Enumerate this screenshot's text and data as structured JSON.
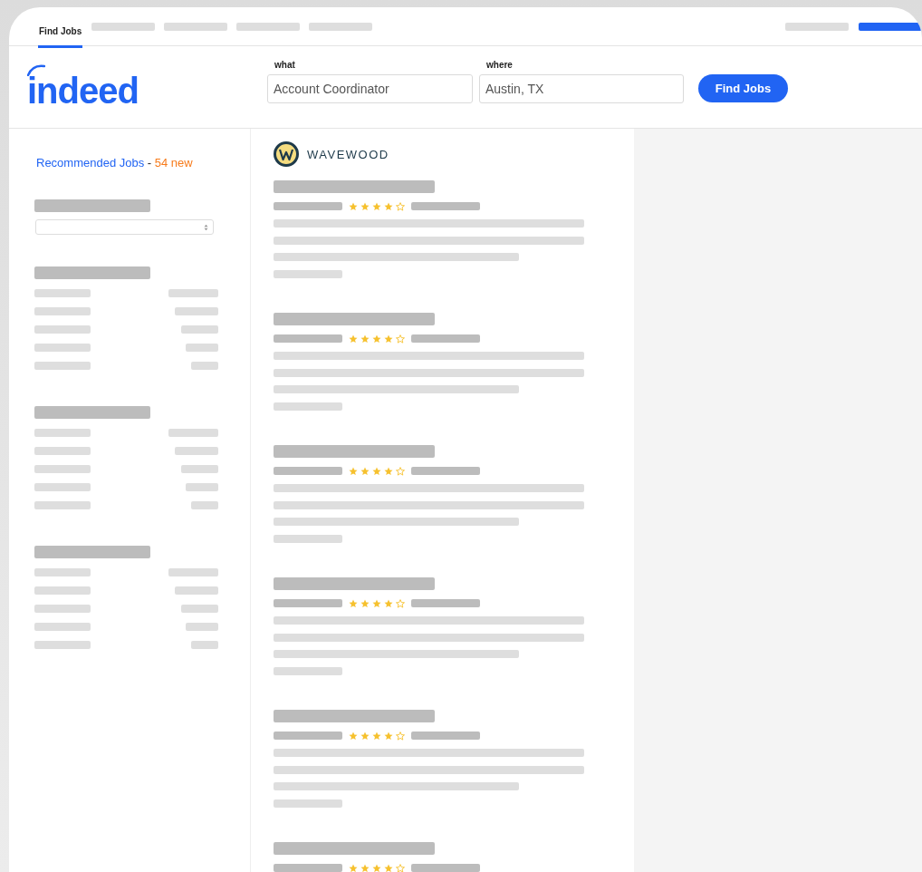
{
  "nav": {
    "tabs": [
      {
        "label": "Find Jobs",
        "selected": true
      }
    ]
  },
  "logo": {
    "text": "indeed"
  },
  "search": {
    "what": {
      "label": "what",
      "value": "Account Coordinator"
    },
    "where": {
      "label": "where",
      "value": "Austin, TX"
    },
    "button": "Find Jobs"
  },
  "sidebar": {
    "title": "Recommended Jobs",
    "separator": "-",
    "count": "54 new"
  },
  "company": {
    "name": "WAVEWOOD"
  },
  "jobs": [
    {
      "stars": 4
    },
    {
      "stars": 4
    },
    {
      "stars": 4
    },
    {
      "stars": 4
    },
    {
      "stars": 4
    },
    {
      "stars": 4
    }
  ]
}
